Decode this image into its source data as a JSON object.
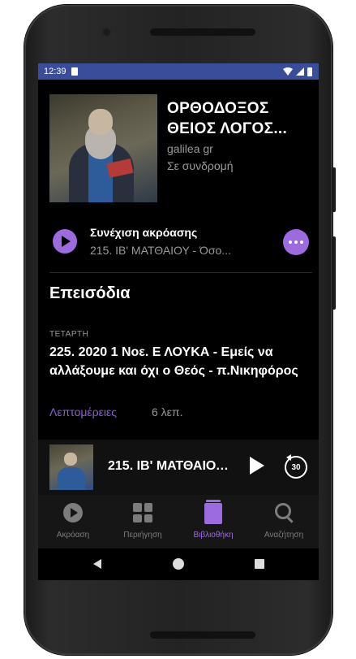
{
  "status_bar": {
    "time": "12:39"
  },
  "podcast": {
    "title": "ΟΡΘΟΔΟΞΟΣ ΘΕΙΟΣ ΛΟΓΟΣ...",
    "author": "galilea gr",
    "subscription": "Σε συνδρομή"
  },
  "continue": {
    "label": "Συνέχιση ακρόασης",
    "episode": "215. ΙΒ' ΜΑΤΘΑΙΟΥ - Όσο..."
  },
  "episodes_section": {
    "title": "Επεισόδια",
    "items": [
      {
        "day": "ΤΕΤΑΡΤΗ",
        "title": "225. 2020 1 Νοε. Ε ΛΟΥΚΑ - Εμείς να αλλάξουμε και όχι ο Θεός - π.Νικηφόρος",
        "details_label": "Λεπτομέρειες",
        "duration": "6 λεπ."
      }
    ]
  },
  "mini_player": {
    "title": "215. ΙΒ' ΜΑΤΘΑΙΟΥ - Όσο",
    "skip_seconds": "30"
  },
  "bottom_nav": {
    "items": [
      {
        "label": "Ακρόαση",
        "icon": "play-circle-icon",
        "active": false
      },
      {
        "label": "Περιήγηση",
        "icon": "grid-icon",
        "active": false
      },
      {
        "label": "Βιβλιοθήκη",
        "icon": "library-icon",
        "active": true
      },
      {
        "label": "Αναζήτηση",
        "icon": "search-icon",
        "active": false
      }
    ]
  },
  "colors": {
    "accent": "#9c6bdf",
    "status_bar": "#3a4d9a",
    "background": "#000000"
  }
}
